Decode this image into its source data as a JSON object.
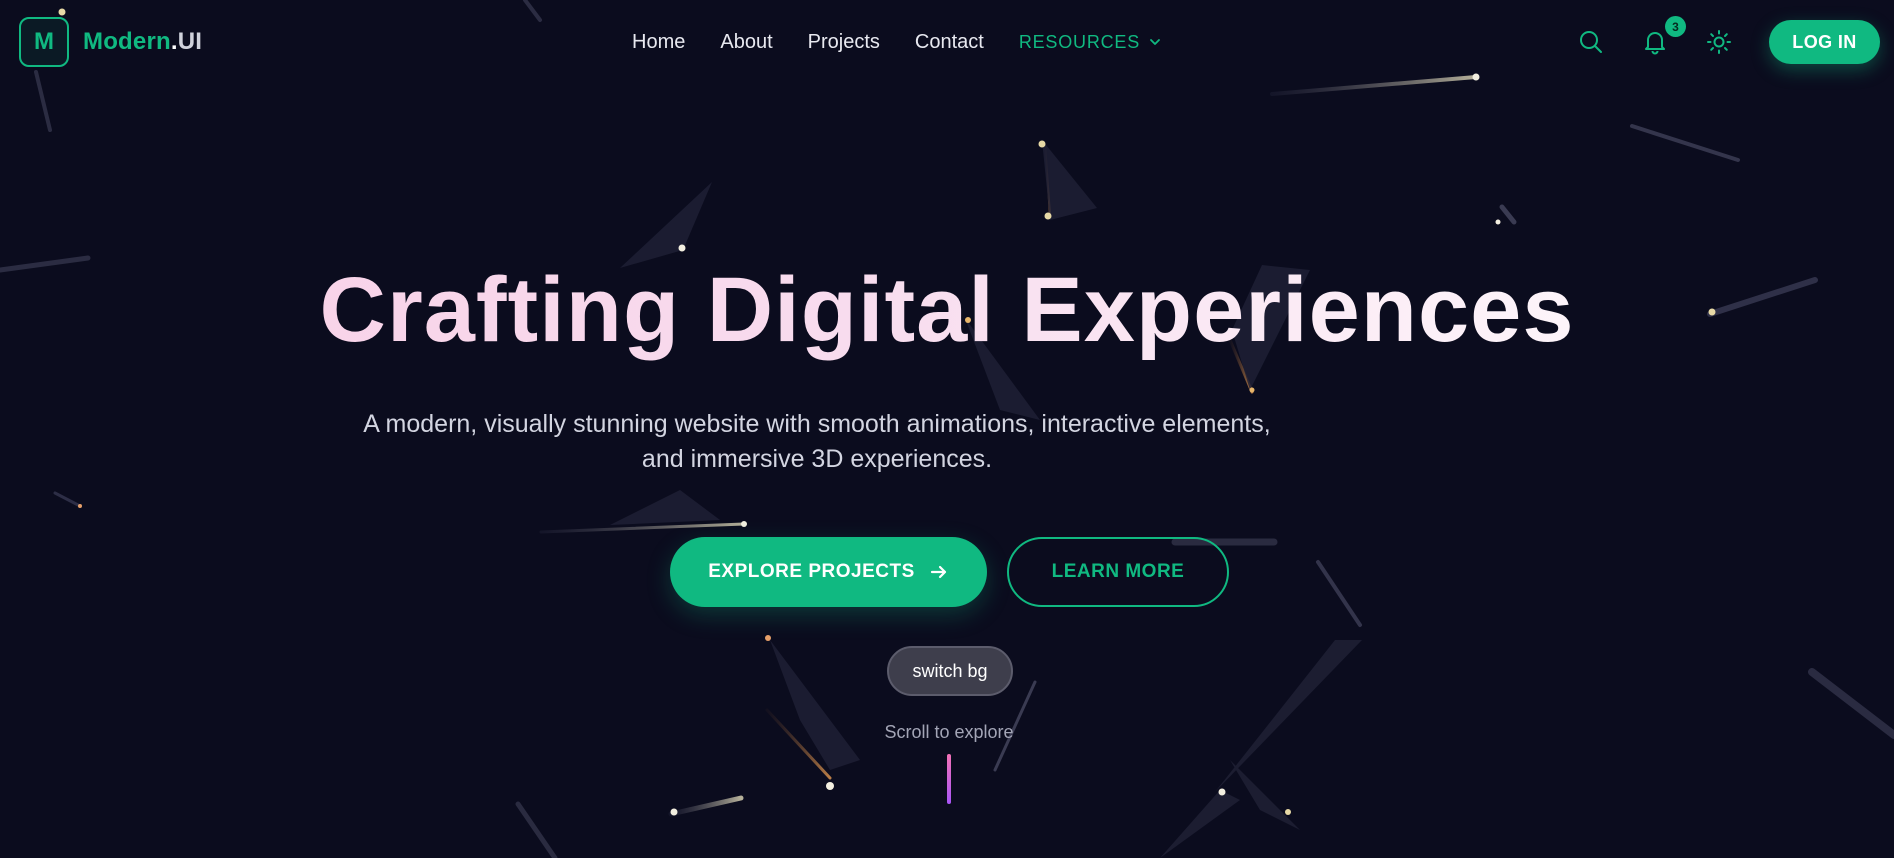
{
  "brand": {
    "logo_letter": "M",
    "name_part1": "Modern",
    "name_part2": ".",
    "name_part3": "UI"
  },
  "nav": {
    "items": [
      {
        "label": "Home"
      },
      {
        "label": "About"
      },
      {
        "label": "Projects"
      },
      {
        "label": "Contact"
      }
    ],
    "resources_label": "RESOURCES"
  },
  "actions": {
    "search_icon": "search-icon",
    "bell_icon": "bell-icon",
    "notification_count": "3",
    "theme_icon": "sun-icon",
    "login_label": "LOG IN"
  },
  "hero": {
    "title": "Crafting Digital Experiences",
    "subtitle": "A modern, visually stunning website with smooth animations, interactive elements, and immersive 3D experiences.",
    "primary_button": "EXPLORE PROJECTS",
    "secondary_button": "LEARN MORE",
    "switch_bg_label": "switch bg",
    "scroll_hint": "Scroll to explore"
  },
  "colors": {
    "background": "#0b0c1e",
    "accent": "#10b981",
    "title_gradient_start": "#f9cfe6",
    "scroll_gradient_start": "#f472b6",
    "scroll_gradient_end": "#a855f7"
  }
}
